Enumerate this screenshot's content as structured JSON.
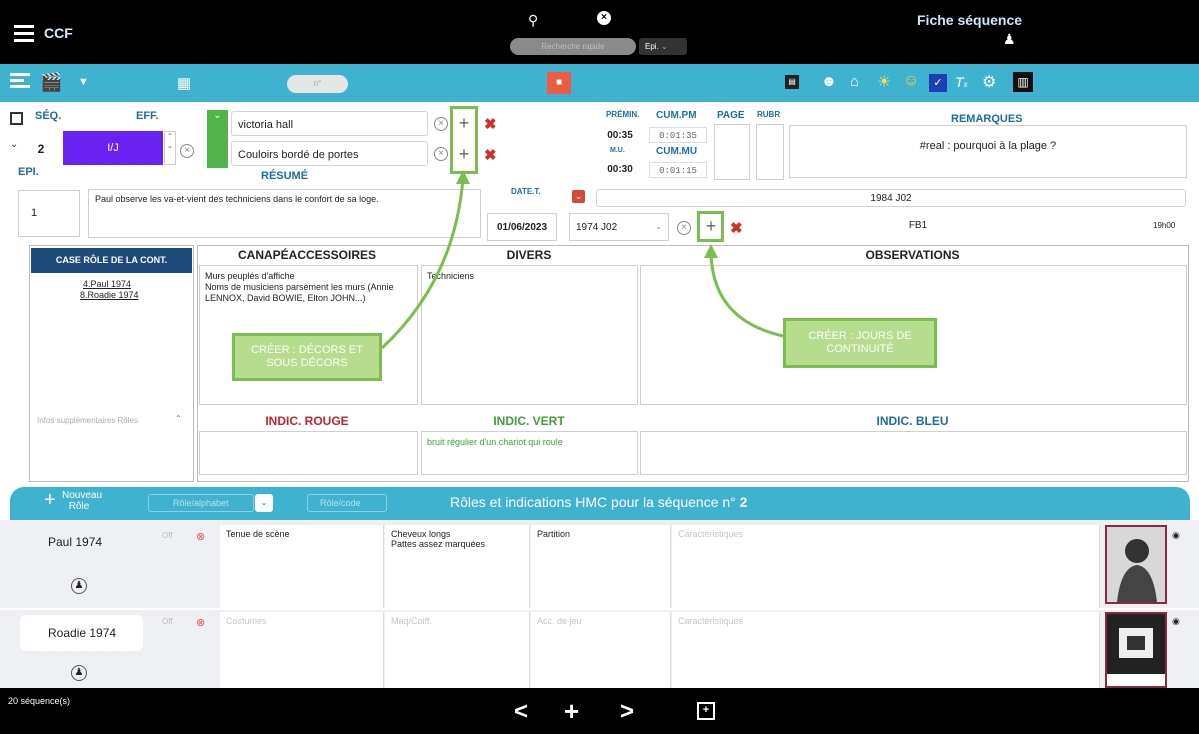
{
  "app": {
    "name": "CCF",
    "title": "Fiche séquence",
    "search_placeholder": "Recherche rapide",
    "epi_label": "Epi."
  },
  "toolbar": {
    "counter_placeholder": "n°"
  },
  "sequence": {
    "seq_label": "SÉQ.",
    "seq_value": "2",
    "eff_label": "EFF.",
    "eff_value": "I/J",
    "epi_label": "EPI.",
    "epi_value": "1",
    "decor1": "victoria hall",
    "decor2": "Couloirs bordé de portes",
    "resume_label": "RÉSUMÉ",
    "resume_text": "Paul observe les va-et-vient des techniciens dans le confort de sa loge.",
    "premin_label": "PRÉMIN.",
    "premin_value": "00:35",
    "mu_label": "M.U.",
    "mu_value": "00:30",
    "cumpm_label": "CUM.PM",
    "cumpm_value": "0:01:35",
    "cummu_label": "CUM.MU",
    "cummu_value": "0:01:15",
    "page_label": "PAGE",
    "rubr_label": "RUBR",
    "remarques_label": "REMARQUES",
    "remarques_text": "#real : pourquoi à la plage ?",
    "datet_label": "DATE.T.",
    "date_value": "01/06/2023",
    "jour_select": "1974 J02",
    "jour_field1": "1984 J02",
    "jour_field2": "FB1",
    "time_value": "19h00"
  },
  "left_panel": {
    "title": "CASE RÔLE DE LA CONT.",
    "roles": [
      "4.Paul 1974",
      "8.Roadie 1974"
    ],
    "infos_label": "Infos supplémentaires Rôles"
  },
  "sections": {
    "canape_label": "CANAPÉACCESSOIRES",
    "canape_text": "Murs peuplés d'affiche\nNoms de musiciens parsèment les murs (Annie LENNOX, David BOWIE, Elton JOHN...)",
    "divers_label": "DIVERS",
    "divers_text": "Techniciens",
    "observations_label": "OBSERVATIONS",
    "rouge_label": "INDIC. ROUGE",
    "vert_label": "INDIC. VERT",
    "vert_text": "bruit régulier d'un chariot qui roule",
    "bleu_label": "INDIC. BLEU"
  },
  "callouts": {
    "decors": "CRÉER : DÉCORS ET SOUS DÉCORS",
    "jours": "CRÉER : JOURS DE CONTINUITÉ"
  },
  "roles_bar": {
    "new_role": "Nouveau Rôle",
    "alpha_placeholder": "Rôle/alphabet",
    "code_placeholder": "Rôle/code",
    "title": "Rôles et indications HMC pour la séquence n°",
    "seq_num": "2"
  },
  "role_rows": [
    {
      "name": "Paul 1974",
      "off": "Off",
      "costume": "Tenue de scène",
      "maq": "Cheveux longs\nPattes assez marquées",
      "acc": "Partition",
      "carac": "Caractéristiques"
    },
    {
      "name": "Roadie 1974",
      "off": "Off",
      "costume": "Costumes",
      "maq": "Maq/Coiff.",
      "acc": "Acc. de jeu",
      "carac": "Caractéristiques"
    }
  ],
  "footer": {
    "count": "20 séquence(s)"
  },
  "colors": {
    "toolbar": "#3fb2cf",
    "accent_purple": "#6a22f0",
    "accent_green": "#4fb54a",
    "red": "#d42b2b",
    "callout_green": "#7bbd4f"
  }
}
